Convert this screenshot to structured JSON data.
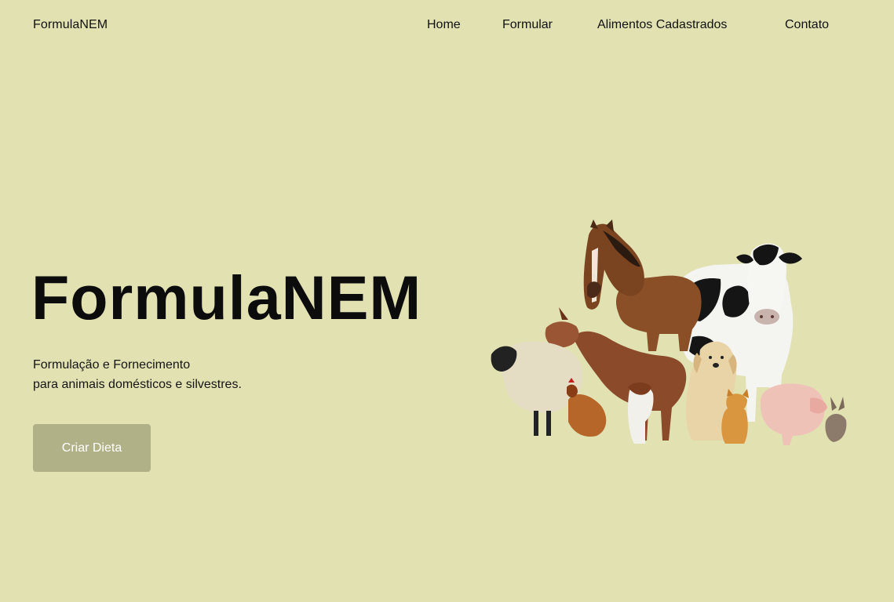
{
  "header": {
    "logo": "FormulaNEM",
    "nav": [
      {
        "label": "Home"
      },
      {
        "label": "Formular"
      },
      {
        "label": "Alimentos Cadastrados"
      },
      {
        "label": "Contato"
      }
    ]
  },
  "hero": {
    "title": "FormulaNEM",
    "subtitle_line1": "Formulação e Fornecimento",
    "subtitle_line2": "para animais domésticos e silvestres.",
    "cta_label": "Criar Dieta",
    "image_name": "farm-animals-illustration"
  },
  "colors": {
    "background": "#e1e1b2",
    "button": "#b1b188",
    "button_text": "#ffffff",
    "text": "#111111"
  }
}
